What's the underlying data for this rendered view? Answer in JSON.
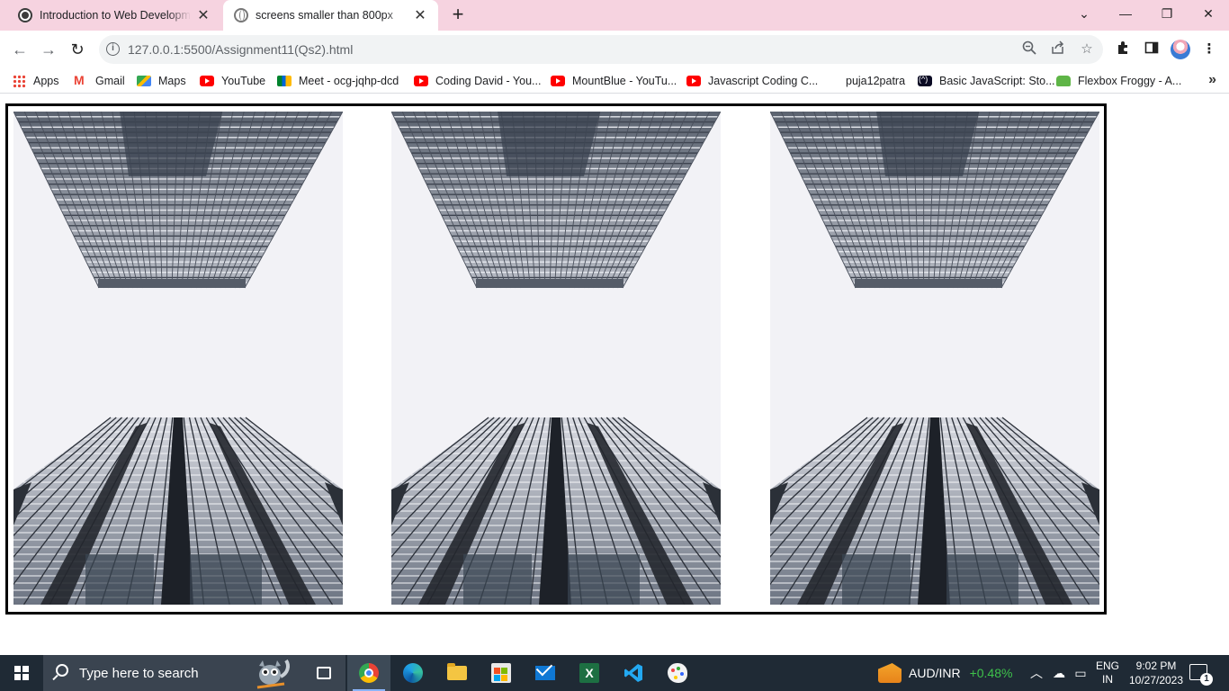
{
  "tabs": [
    {
      "title": "Introduction to Web Developme",
      "active": false,
      "favicon": "wordpress-icon"
    },
    {
      "title": "screens smaller than 800px",
      "active": true,
      "favicon": "globe-icon"
    }
  ],
  "window_controls": {
    "tab_search": "⌄",
    "minimize": "—",
    "restore": "❐",
    "close": "✕"
  },
  "toolbar": {
    "back": "←",
    "forward": "→",
    "reload": "↻",
    "url": "127.0.0.1:5500/Assignment11(Qs2).html",
    "info_glyph": "i"
  },
  "bookmarks": [
    {
      "label": "Apps",
      "icon": "apps"
    },
    {
      "label": "Gmail",
      "icon": "gmail"
    },
    {
      "label": "Maps",
      "icon": "maps"
    },
    {
      "label": "YouTube",
      "icon": "yt"
    },
    {
      "label": "Meet - ocg-jqhp-dcd",
      "icon": "meet"
    },
    {
      "label": "Coding David - You...",
      "icon": "yt"
    },
    {
      "label": "MountBlue - YouTu...",
      "icon": "yt"
    },
    {
      "label": "Javascript Coding C...",
      "icon": "yt"
    },
    {
      "label": "puja12patra",
      "icon": "none"
    },
    {
      "label": "Basic JavaScript: Sto...",
      "icon": "fcc"
    },
    {
      "label": "Flexbox Froggy - A...",
      "icon": "froggy"
    }
  ],
  "bookmarks_more": "»",
  "page": {
    "images": [
      {
        "alt": "skyscrapers looking up"
      },
      {
        "alt": "skyscrapers looking up"
      },
      {
        "alt": "skyscrapers looking up"
      }
    ]
  },
  "taskbar": {
    "search_placeholder": "Type here to search",
    "apps": [
      "task-view",
      "chrome",
      "edge",
      "file-explorer",
      "microsoft-store",
      "mail",
      "excel",
      "vscode",
      "paint"
    ],
    "ticker": {
      "symbol": "AUD/INR",
      "change": "+0.48%",
      "change_color": "#3ec24b"
    },
    "language": {
      "line1": "ENG",
      "line2": "IN"
    },
    "clock": {
      "time": "9:02 PM",
      "date": "10/27/2023"
    },
    "notifications_count": "1"
  }
}
